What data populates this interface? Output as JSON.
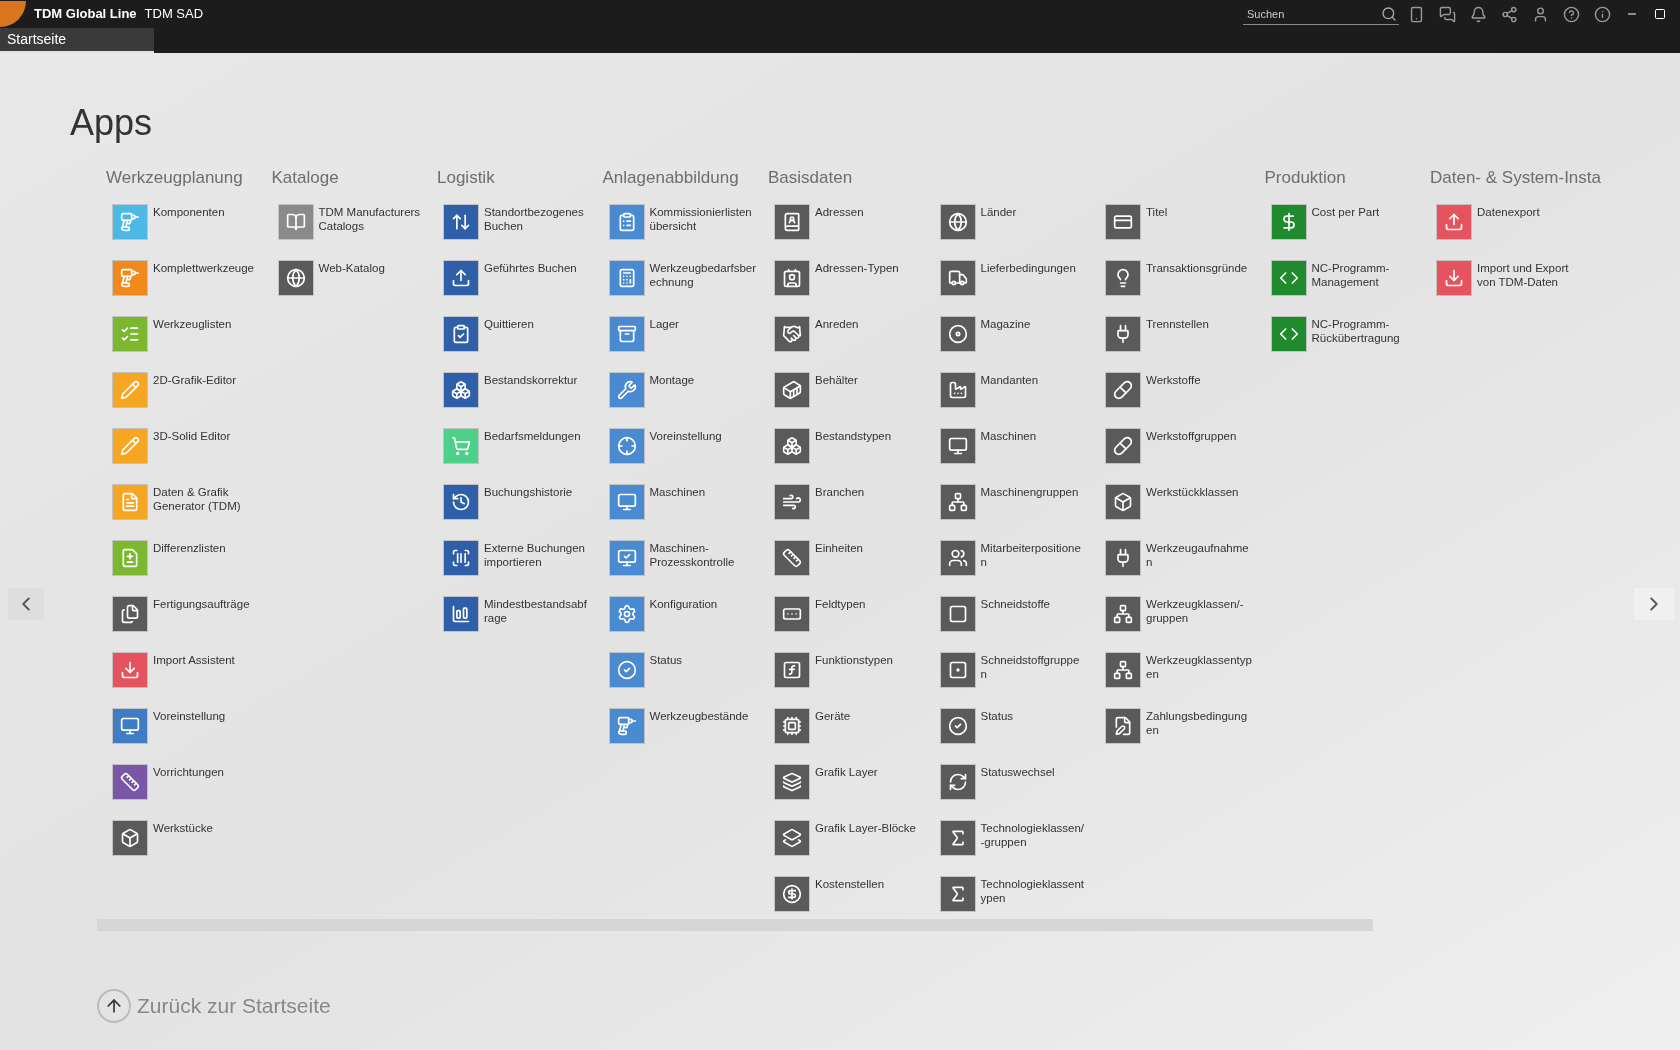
{
  "titlebar": {
    "brand": "TDM Global Line",
    "product": "TDM SAD",
    "search": {
      "placeholder": "Suchen"
    }
  },
  "tabs": [
    {
      "label": "Startseite",
      "selected": true
    }
  ],
  "page_title": "Apps",
  "groups": [
    {
      "title": "Werkzeugplanung",
      "columns": [
        [
          {
            "label": "Komponenten",
            "color": "#4cb8e6"
          },
          {
            "label": "Komplettwerkzeuge",
            "color": "#f08a1c"
          },
          {
            "label": "Werkzeuglisten",
            "color": "#7cb82f"
          },
          {
            "label": "2D-Grafik-Editor",
            "color": "#f5a623"
          },
          {
            "label": "3D-Solid Editor",
            "color": "#f5a623"
          },
          {
            "label": "Daten & Grafik Generator (TDM)",
            "color": "#f5a623"
          },
          {
            "label": "Differenzlisten",
            "color": "#7cb82f"
          },
          {
            "label": "Fertigungsaufträge",
            "color": "#5a5a5a"
          },
          {
            "label": "Import Assistent",
            "color": "#e5545e"
          },
          {
            "label": "Voreinstellung",
            "color": "#3f7cc4"
          },
          {
            "label": "Vorrichtungen",
            "color": "#7a56a6"
          },
          {
            "label": "Werkstücke",
            "color": "#5a5a5a"
          }
        ]
      ]
    },
    {
      "title": "Kataloge",
      "columns": [
        [
          {
            "label": "TDM Manufacturers Catalogs",
            "color": "#8a8a8a"
          },
          {
            "label": "Web-Katalog",
            "color": "#5a5a5a"
          }
        ]
      ]
    },
    {
      "title": "Logistik",
      "columns": [
        [
          {
            "label": "Standortbezogenes Buchen",
            "color": "#2f5fa8"
          },
          {
            "label": "Geführtes Buchen",
            "color": "#2f5fa8"
          },
          {
            "label": "Quittieren",
            "color": "#2f5fa8"
          },
          {
            "label": "Bestandskorrektur",
            "color": "#2f5fa8"
          },
          {
            "label": "Bedarfsmeldungen",
            "color": "#4cd08a"
          },
          {
            "label": "Buchungshistorie",
            "color": "#2f5fa8"
          },
          {
            "label": "Externe Buchungen importieren",
            "color": "#2f5fa8"
          },
          {
            "label": "Mindestbestandsabf\nrage",
            "color": "#2f5fa8"
          }
        ]
      ]
    },
    {
      "title": "Anlagenabbildung",
      "columns": [
        [
          {
            "label": "Kommissionierlisten übersicht",
            "color": "#4a8ad0"
          },
          {
            "label": "Werkzeugbedarfsber\nechnung",
            "color": "#4a8ad0"
          },
          {
            "label": "Lager",
            "color": "#4a8ad0"
          },
          {
            "label": "Montage",
            "color": "#4a8ad0"
          },
          {
            "label": "Voreinstellung",
            "color": "#4a8ad0"
          },
          {
            "label": "Maschinen",
            "color": "#4a8ad0"
          },
          {
            "label": "Maschinen-\nProzesskontrolle",
            "color": "#4a8ad0"
          },
          {
            "label": "Konfiguration",
            "color": "#4a8ad0"
          },
          {
            "label": "Status",
            "color": "#4a8ad0"
          },
          {
            "label": "Werkzeugbestände",
            "color": "#4a8ad0"
          }
        ]
      ]
    },
    {
      "title": "Basisdaten",
      "columns": [
        [
          {
            "label": "Adressen",
            "color": "#5a5a5a"
          },
          {
            "label": "Adressen-Typen",
            "color": "#5a5a5a"
          },
          {
            "label": "Anreden",
            "color": "#5a5a5a"
          },
          {
            "label": "Behälter",
            "color": "#5a5a5a"
          },
          {
            "label": "Bestandstypen",
            "color": "#5a5a5a"
          },
          {
            "label": "Branchen",
            "color": "#5a5a5a"
          },
          {
            "label": "Einheiten",
            "color": "#5a5a5a"
          },
          {
            "label": "Feldtypen",
            "color": "#5a5a5a"
          },
          {
            "label": "Funktionstypen",
            "color": "#5a5a5a"
          },
          {
            "label": "Geräte",
            "color": "#5a5a5a"
          },
          {
            "label": "Grafik Layer",
            "color": "#5a5a5a"
          },
          {
            "label": "Grafik Layer-Blöcke",
            "color": "#5a5a5a"
          },
          {
            "label": "Kostenstellen",
            "color": "#5a5a5a"
          }
        ],
        [
          {
            "label": "Länder",
            "color": "#5a5a5a"
          },
          {
            "label": "Lieferbedingungen",
            "color": "#5a5a5a"
          },
          {
            "label": "Magazine",
            "color": "#5a5a5a"
          },
          {
            "label": "Mandanten",
            "color": "#5a5a5a"
          },
          {
            "label": "Maschinen",
            "color": "#5a5a5a"
          },
          {
            "label": "Maschinengruppen",
            "color": "#5a5a5a"
          },
          {
            "label": "Mitarbeiterpositione\nn",
            "color": "#5a5a5a"
          },
          {
            "label": "Schneidstoffe",
            "color": "#5a5a5a"
          },
          {
            "label": "Schneidstoffgruppe\nn",
            "color": "#5a5a5a"
          },
          {
            "label": "Status",
            "color": "#5a5a5a"
          },
          {
            "label": "Statuswechsel",
            "color": "#5a5a5a"
          },
          {
            "label": "Technologieklassen/\n-gruppen",
            "color": "#5a5a5a"
          },
          {
            "label": "Technologieklassent\nypen",
            "color": "#5a5a5a"
          }
        ],
        [
          {
            "label": "Titel",
            "color": "#5a5a5a"
          },
          {
            "label": "Transaktionsgründe",
            "color": "#5a5a5a"
          },
          {
            "label": "Trennstellen",
            "color": "#5a5a5a"
          },
          {
            "label": "Werkstoffe",
            "color": "#5a5a5a"
          },
          {
            "label": "Werkstoffgruppen",
            "color": "#5a5a5a"
          },
          {
            "label": "Werkstückklassen",
            "color": "#5a5a5a"
          },
          {
            "label": "Werkzeugaufnahme\nn",
            "color": "#5a5a5a"
          },
          {
            "label": "Werkzeugklassen/-\ngruppen",
            "color": "#5a5a5a"
          },
          {
            "label": "Werkzeugklassentyp\nen",
            "color": "#5a5a5a"
          },
          {
            "label": "Zahlungsbedingung\nen",
            "color": "#5a5a5a"
          }
        ]
      ]
    },
    {
      "title": "Produktion",
      "columns": [
        [
          {
            "label": "Cost per Part",
            "color": "#1f8a2e"
          },
          {
            "label": "NC-Programm-\nManagement",
            "color": "#1f8a2e"
          },
          {
            "label": "NC-Programm-\nRückübertragung",
            "color": "#1f8a2e"
          }
        ]
      ]
    },
    {
      "title": "Daten- & System-Insta",
      "columns": [
        [
          {
            "label": "Datenexport",
            "color": "#e5545e"
          },
          {
            "label": "Import und Export\nvon TDM-Daten",
            "color": "#e5545e"
          }
        ]
      ]
    }
  ],
  "back_link": "Zurück zur Startseite"
}
